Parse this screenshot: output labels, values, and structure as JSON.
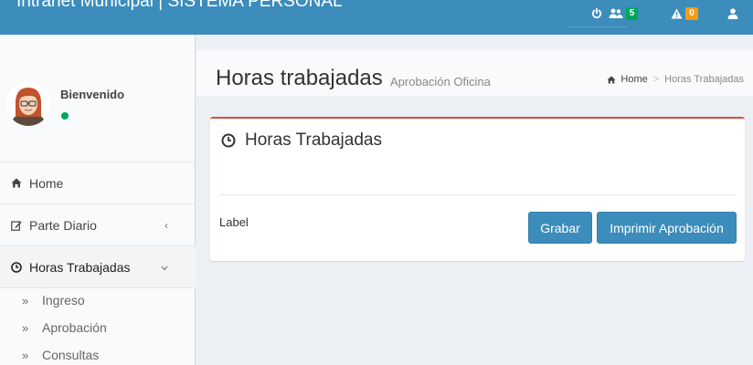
{
  "app": {
    "title": "Intranet Municipal | SISTEMA PERSONAL"
  },
  "navbar": {
    "users_count": "5",
    "alerts_count": "0"
  },
  "sidebar": {
    "welcome": "Bienvenido",
    "items": [
      {
        "label": "Home",
        "icon": "home-icon"
      },
      {
        "label": "Parte Diario",
        "icon": "edit-icon"
      },
      {
        "label": "Horas Trabajadas",
        "icon": "clock-icon"
      }
    ],
    "subitems": [
      {
        "label": "Ingreso"
      },
      {
        "label": "Aprobación"
      },
      {
        "label": "Consultas"
      }
    ]
  },
  "header": {
    "title": "Horas trabajadas",
    "subtitle": "Aprobación Oficina",
    "breadcrumb": {
      "home": "Home",
      "current": "Horas Trabajadas"
    }
  },
  "box": {
    "title": "Horas Trabajadas",
    "label": "Label",
    "buttons": {
      "grabar": "Grabar",
      "imprimir": "Imprimir Aprobación"
    }
  },
  "colors": {
    "primary": "#3c8dbc",
    "danger": "#dd4b39",
    "success": "#00a65a",
    "warning": "#f39c12"
  }
}
